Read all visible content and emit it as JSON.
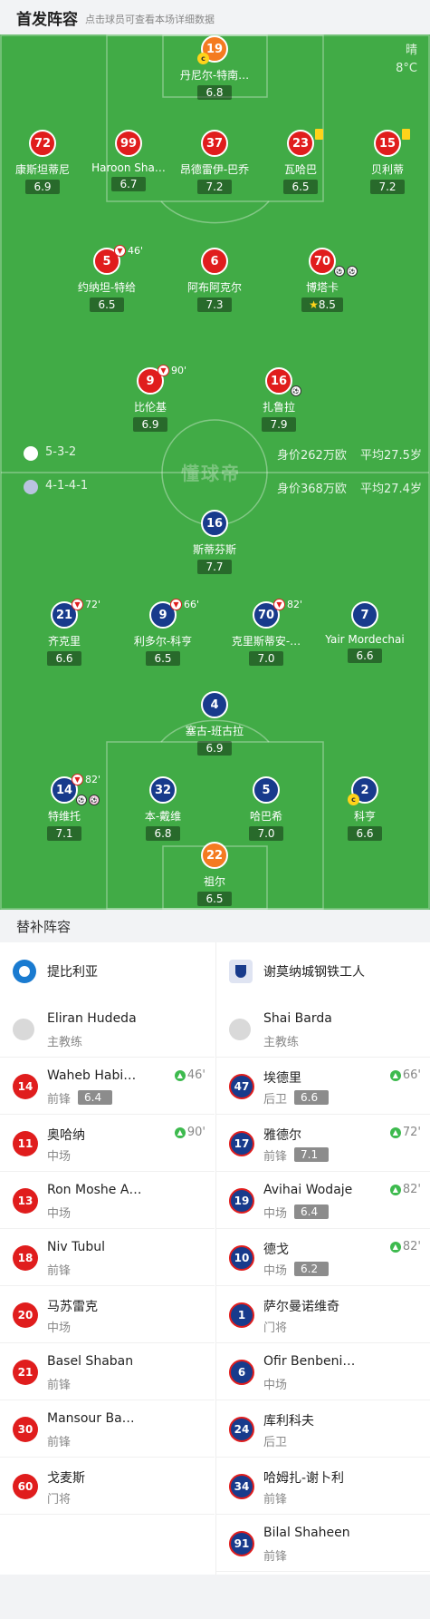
{
  "header": {
    "title": "首发阵容",
    "subtitle": "点击球员可查看本场详细数据"
  },
  "weather": {
    "condition": "晴",
    "temp": "8°C"
  },
  "watermark": "懂球帝",
  "home": {
    "form": "5-3-2",
    "value": "身价262万欧",
    "age": "平均27.5岁",
    "players": [
      {
        "num": "19",
        "name": "丹尼尔-特南…",
        "rating": "6.8"
      },
      {
        "num": "72",
        "name": "康斯坦蒂尼",
        "rating": "6.9"
      },
      {
        "num": "99",
        "name": "Haroon Sha…",
        "rating": "6.7"
      },
      {
        "num": "37",
        "name": "昂德雷伊-巴乔",
        "rating": "7.2"
      },
      {
        "num": "23",
        "name": "瓦哈巴",
        "rating": "6.5"
      },
      {
        "num": "15",
        "name": "贝利蒂",
        "rating": "7.2"
      },
      {
        "num": "5",
        "name": "约纳坦-特给",
        "rating": "6.5",
        "event": "46'"
      },
      {
        "num": "6",
        "name": "阿布阿克尔",
        "rating": "7.3"
      },
      {
        "num": "70",
        "name": "博塔卡",
        "rating": "8.5"
      },
      {
        "num": "9",
        "name": "比伦基",
        "rating": "6.9",
        "event": "90'"
      },
      {
        "num": "16",
        "name": "扎鲁拉",
        "rating": "7.9"
      }
    ]
  },
  "away": {
    "form": "4-1-4-1",
    "value": "身价368万欧",
    "age": "平均27.4岁",
    "players": [
      {
        "num": "16",
        "name": "斯蒂芬斯",
        "rating": "7.7"
      },
      {
        "num": "21",
        "name": "齐克里",
        "rating": "6.6",
        "event": "72'"
      },
      {
        "num": "9",
        "name": "利多尔-科亨",
        "rating": "6.5",
        "event": "66'"
      },
      {
        "num": "70",
        "name": "克里斯蒂安-…",
        "rating": "7.0",
        "event": "82'"
      },
      {
        "num": "7",
        "name": "Yair Mordechai",
        "rating": "6.6"
      },
      {
        "num": "4",
        "name": "塞古-班古拉",
        "rating": "6.9"
      },
      {
        "num": "14",
        "name": "特维托",
        "rating": "7.1",
        "event": "82'"
      },
      {
        "num": "32",
        "name": "本-戴维",
        "rating": "6.8"
      },
      {
        "num": "5",
        "name": "哈巴希",
        "rating": "7.0"
      },
      {
        "num": "2",
        "name": "科亨",
        "rating": "6.6"
      },
      {
        "num": "22",
        "name": "祖尔",
        "rating": "6.5"
      }
    ]
  },
  "subs": {
    "title": "替补阵容",
    "home_team": "提比利亚",
    "away_team": "谢莫纳城钢铁工人",
    "home_coach": {
      "name": "Eliran Hudeda",
      "role": "主教练"
    },
    "away_coach": {
      "name": "Shai Barda",
      "role": "主教练"
    },
    "home": [
      {
        "num": "14",
        "name": "Waheb Habib…",
        "pos": "前锋",
        "rating": "6.4",
        "min": "46'"
      },
      {
        "num": "11",
        "name": "奥哈纳",
        "pos": "中场",
        "min": "90'"
      },
      {
        "num": "13",
        "name": "Ron Moshe A…",
        "pos": "中场"
      },
      {
        "num": "18",
        "name": "Niv Tubul",
        "pos": "前锋"
      },
      {
        "num": "20",
        "name": "马苏雷克",
        "pos": "中场"
      },
      {
        "num": "21",
        "name": "Basel Shaban",
        "pos": "前锋"
      },
      {
        "num": "30",
        "name": "Mansour Badjie",
        "pos": "前锋"
      },
      {
        "num": "60",
        "name": "戈麦斯",
        "pos": "门将"
      }
    ],
    "away": [
      {
        "num": "47",
        "name": "埃德里",
        "pos": "后卫",
        "rating": "6.6",
        "min": "66'"
      },
      {
        "num": "17",
        "name": "雅德尔",
        "pos": "前锋",
        "rating": "7.1",
        "min": "72'"
      },
      {
        "num": "19",
        "name": "Avihai Wodaje",
        "pos": "中场",
        "rating": "6.4",
        "min": "82'"
      },
      {
        "num": "10",
        "name": "德戈",
        "pos": "中场",
        "rating": "6.2",
        "min": "82'"
      },
      {
        "num": "1",
        "name": "萨尔曼诺维奇",
        "pos": "门将"
      },
      {
        "num": "6",
        "name": "Ofir Benbenishti",
        "pos": "中场"
      },
      {
        "num": "24",
        "name": "库利科夫",
        "pos": "后卫"
      },
      {
        "num": "34",
        "name": "哈姆扎-谢卜利",
        "pos": "前锋"
      },
      {
        "num": "91",
        "name": "Bilal Shaheen",
        "pos": "前锋"
      }
    ]
  }
}
